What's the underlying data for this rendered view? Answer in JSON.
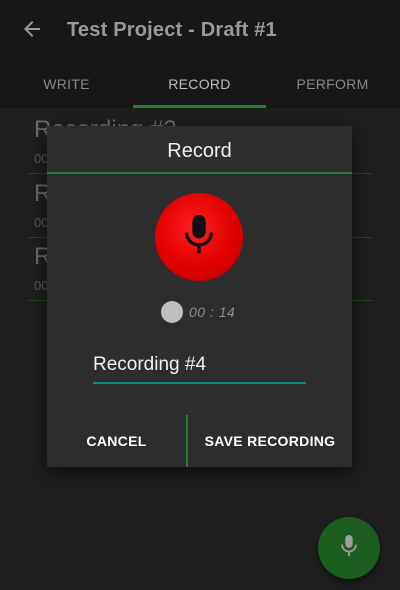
{
  "appbar": {
    "title": "Test Project - Draft #1",
    "back_icon": "arrow-left-icon"
  },
  "tabs": [
    {
      "label": "WRITE",
      "selected": false
    },
    {
      "label": "RECORD",
      "selected": true
    },
    {
      "label": "PERFORM",
      "selected": false
    }
  ],
  "recordings": [
    {
      "title": "Recording #3",
      "subtitle": "00"
    },
    {
      "title": "R",
      "subtitle": "00"
    },
    {
      "title": "R",
      "subtitle": "00"
    }
  ],
  "dialog": {
    "title": "Record",
    "record_icon": "microphone-icon",
    "timer": "00 : 14",
    "name_value": "Recording #4",
    "cancel_label": "CANCEL",
    "save_label": "SAVE RECORDING"
  },
  "fab": {
    "icon": "microphone-icon"
  },
  "colors": {
    "accent": "#2e7d32",
    "record_red": "#e00000",
    "input_underline": "#0f8a7e",
    "fab": "#1b5e20"
  }
}
